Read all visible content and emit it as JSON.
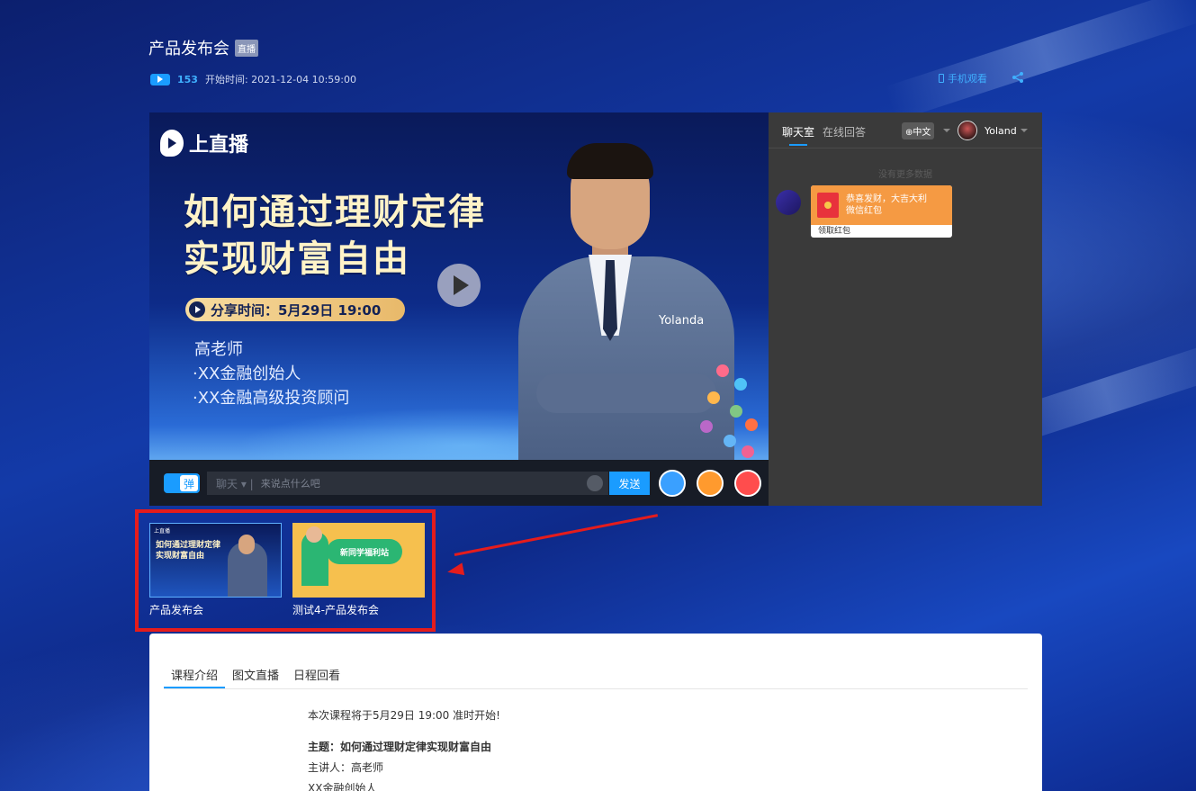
{
  "header": {
    "title": "产品发布会",
    "live_tag": "直播",
    "viewers": "153",
    "start_time": "开始时间: 2021-12-04 10:59:00",
    "mobile_watch": "手机观看"
  },
  "video": {
    "logo_text": "上直播",
    "headline_line1": "如何通过理财定律",
    "headline_line2": "实现财富自由",
    "share_time": "分享时间：5月29日 19:00",
    "teacher_name": "高老师",
    "teacher_title1": "·XX金融创始人",
    "teacher_title2": "·XX金融高级投资顾问",
    "presenter_watermark": "Yolanda"
  },
  "controls": {
    "danmu_label": "弹",
    "chat_mode": "聊天 ▾ |",
    "input_placeholder": "来说点什么吧",
    "send_label": "发送"
  },
  "chat": {
    "tab_chatroom": "聊天室",
    "tab_answers": "在线回答",
    "language": "⊕中文",
    "user_name": "Yoland",
    "no_more": "没有更多数据",
    "redpacket_line1": "恭喜发财，大吉大利",
    "redpacket_line2": "微信红包",
    "redpacket_action": "领取红包"
  },
  "playlist": [
    {
      "label": "产品发布会"
    },
    {
      "label": "测试4-产品发布会"
    }
  ],
  "thumbs": {
    "t1_logo": "上直播",
    "t1_line1": "如何通过理财定律",
    "t1_line2": "实现财富自由",
    "t2_banner": "新同学福利站"
  },
  "content": {
    "tabs": [
      "课程介绍",
      "图文直播",
      "日程回看"
    ],
    "line1": "本次课程将于5月29日 19:00 准时开始!",
    "topic": "主题：如何通过理财定律实现财富自由",
    "speaker": "主讲人：高老师",
    "speaker_title": "XX金融创始人"
  },
  "colors": {
    "accent": "#1a9cff",
    "highlight_box": "#e51c1c",
    "redpacket": "#f59a43"
  }
}
